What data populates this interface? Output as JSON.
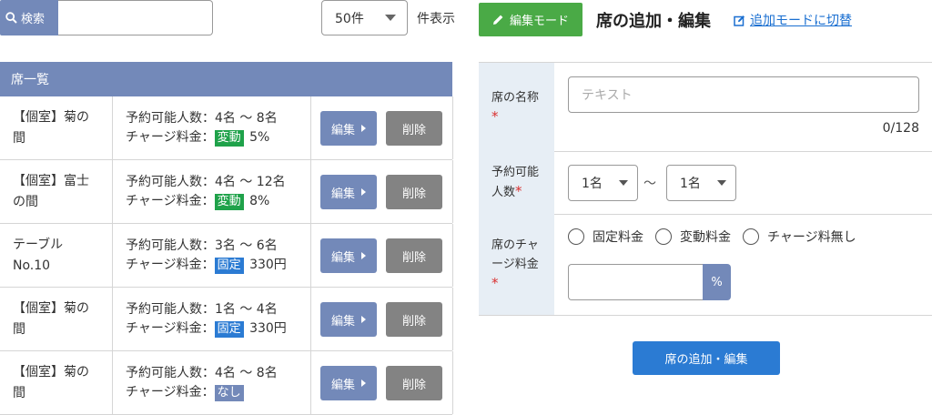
{
  "toolbar": {
    "search_label": "検索",
    "search_value": "",
    "count_value": "50件",
    "count_suffix": "件表示"
  },
  "list": {
    "header": "席一覧",
    "edit_label": "編集",
    "delete_label": "削除",
    "rows": [
      {
        "name": "【個室】菊の間",
        "capacity": "予約可能人数：4名 〜 8名",
        "charge_label": "チャージ料金：",
        "badge": "変動",
        "badge_color": "#1fa24a",
        "charge_value": "5%"
      },
      {
        "name": "【個室】富士の間",
        "capacity": "予約可能人数：4名 〜 12名",
        "charge_label": "チャージ料金：",
        "badge": "変動",
        "badge_color": "#1fa24a",
        "charge_value": "8%"
      },
      {
        "name": "テーブルNo.10",
        "capacity": "予約可能人数：3名 〜 6名",
        "charge_label": "チャージ料金：",
        "badge": "固定",
        "badge_color": "#2b7bd3",
        "charge_value": "330円"
      },
      {
        "name": "【個室】菊の間",
        "capacity": "予約可能人数：1名 〜 4名",
        "charge_label": "チャージ料金：",
        "badge": "固定",
        "badge_color": "#2b7bd3",
        "charge_value": "330円"
      },
      {
        "name": "【個室】菊の間",
        "capacity": "予約可能人数：4名 〜 8名",
        "charge_label": "チャージ料金：",
        "badge": "なし",
        "badge_color": "#7389b9",
        "charge_value": ""
      }
    ]
  },
  "panel": {
    "mode_label": "編集モード",
    "title": "席の追加・編集",
    "switch_link": "追加モードに切替",
    "fields": {
      "name_label_1": "席の名称",
      "name_placeholder": "テキスト",
      "name_counter": "0/128",
      "capacity_label_1": "予約可能",
      "capacity_label_2": "人数",
      "capacity_min": "1名",
      "capacity_tilde": "〜",
      "capacity_max": "1名",
      "charge_label_1": "席のチャ",
      "charge_label_2": "ージ料金",
      "required_mark": "*",
      "radio_fixed": "固定料金",
      "radio_variable": "変動料金",
      "radio_none": "チャージ料無し",
      "charge_unit": "%"
    },
    "submit_label": "席の追加・編集"
  },
  "colors": {
    "accent_blue": "#7389b9",
    "green": "#4aaa46",
    "primary": "#2b7bd3",
    "required": "#d93030"
  }
}
